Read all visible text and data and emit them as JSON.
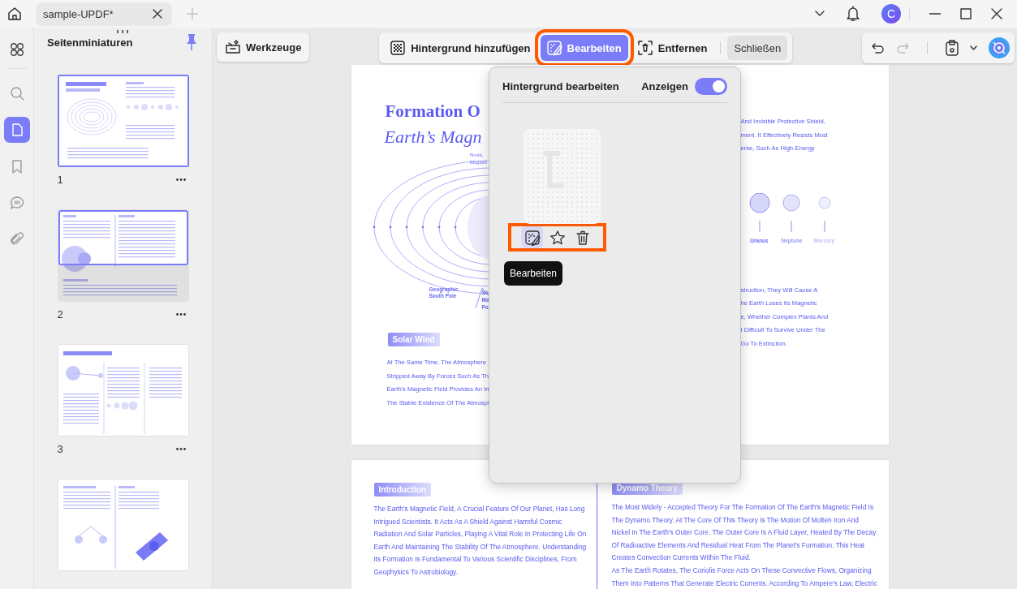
{
  "title_bar": {
    "tabs": [
      {
        "label": "sample-UPDF*"
      }
    ],
    "avatar": "C"
  },
  "left_rail": {
    "items": [
      {
        "kind": "grid",
        "selected": false
      },
      {
        "kind": "search",
        "selected": false
      },
      {
        "kind": "pages",
        "selected": true
      },
      {
        "kind": "bookmark",
        "selected": false
      },
      {
        "kind": "comment",
        "selected": false
      },
      {
        "kind": "attachment",
        "selected": false
      }
    ]
  },
  "sidebar": {
    "title": "Seitenminiaturen",
    "pinned": true,
    "thumbnails": [
      {
        "page": "1",
        "selected": true,
        "in_view": false
      },
      {
        "page": "2",
        "selected": false,
        "in_view": true
      },
      {
        "page": "3",
        "selected": false,
        "in_view": false
      },
      {
        "selected": false,
        "in_view": false
      }
    ]
  },
  "toolbar": {
    "tools_button": "Werkzeuge",
    "background_actions": [
      {
        "kind": "add",
        "label": "Hintergrund hinzufügen",
        "selected": false,
        "highlighted": false
      },
      {
        "kind": "edit",
        "label": "Bearbeiten",
        "selected": true,
        "highlighted": true
      },
      {
        "kind": "remove",
        "label": "Entfernen",
        "selected": false,
        "highlighted": false
      }
    ],
    "close_button": "Schließen",
    "redo_disabled": true
  },
  "document": {
    "pages": [
      {
        "kind": "cover",
        "title": "Formation O",
        "subtitle": "Earth’s Magn",
        "diagram_labels": [
          "North,",
          "Magneti",
          "Geographic",
          "South Pole",
          "So",
          "Ma",
          "Po"
        ],
        "tag": "Solar Wind",
        "left_lines": [
          "At The Same Time, The Atmosphere",
          "Stripped Away By Forces Such As Th",
          "Earth's Magnetic Field Provides An In",
          "The Stable Existence Of The Atmospl"
        ],
        "right_lines_top": [
          "And Invisible Protective Shield,",
          "ment. It Effectively Resists Most",
          "erse, Such As High-Energy"
        ],
        "planets": [
          "Uranus",
          "Neptune",
          "Mercury"
        ],
        "right_lines_bottom": [
          "struction, They Will Cause A",
          "he Earth Loses Its Magnetic",
          "e, Whether Complex Plants And",
          "t Difficult To Survive Under The",
          "Go To Extinction."
        ]
      },
      {
        "kind": "article",
        "columns": [
          {
            "heading": "Introduction",
            "paragraphs": [
              "The Earth's Magnetic Field, A Crucial Feature Of Our Planet, Has Long Intrigued Scientists. It Acts As A Shield Against Harmful Cosmic Radiation And Solar Particles, Playing A Vital Role In Protecting Life On Earth And Maintaining The Stability Of The Atmosphere. Understanding Its Formation Is Fundamental To Various Scientific Disciplines, From Geophysics To Astrobiology."
            ]
          },
          {
            "heading": "Dynamo Theory",
            "paragraphs": [
              "The Most Widely - Accepted Theory For The Formation Of The Earth's Magnetic Field Is The Dynamo Theory. At The Core Of This Theory Is The Motion Of Molten Iron And Nickel In The Earth's Outer Core. The Outer Core Is A Fluid Layer, Heated By The Decay Of Radioactive Elements And Residual Heat From The Planet's Formation. This Heat Creates Convection Currents Within The Fluid.",
              "As The Earth Rotates, The Coriolis Force Acts On These Convective Flows, Organizing Them Into Patterns That Generate Electric Currents. According To Ampere's Law, Electric"
            ]
          }
        ]
      }
    ]
  },
  "popup": {
    "title": "Hintergrund bearbeiten",
    "toggle_label": "Anzeigen",
    "toggle_on": true,
    "actions_highlighted": true,
    "actions": [
      {
        "kind": "edit",
        "selected": true
      },
      {
        "kind": "favorite",
        "selected": false
      },
      {
        "kind": "delete",
        "selected": false
      }
    ],
    "tooltip": "Bearbeiten"
  }
}
